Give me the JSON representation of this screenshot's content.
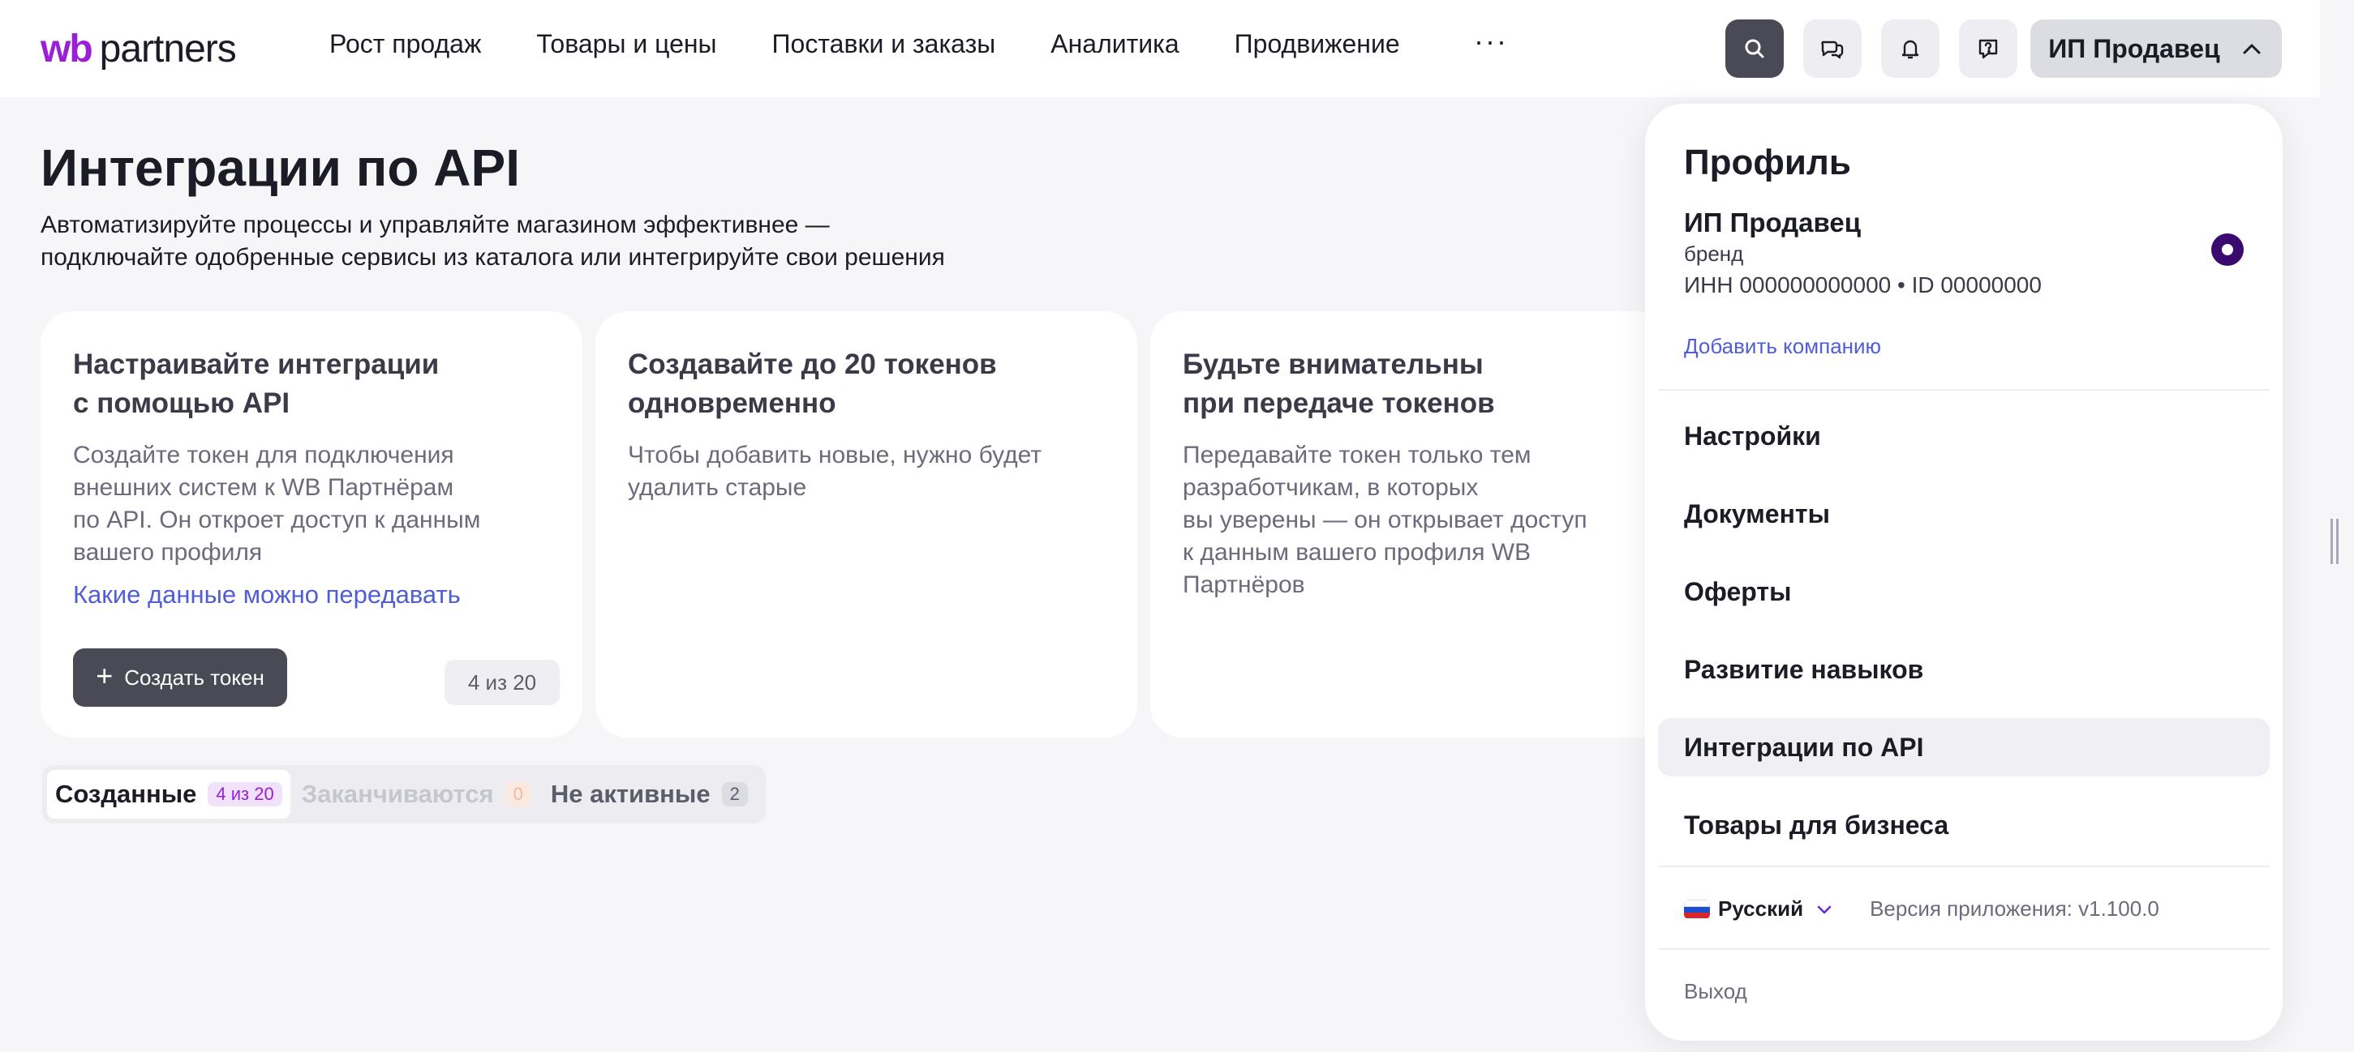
{
  "header": {
    "logo": {
      "wb": "wb",
      "partners": "partners"
    },
    "nav": [
      {
        "label": "Рост продаж"
      },
      {
        "label": "Товары и цены"
      },
      {
        "label": "Поставки и заказы"
      },
      {
        "label": "Аналитика"
      },
      {
        "label": "Продвижение"
      }
    ],
    "more": "···",
    "icons": [
      "search-icon",
      "chat-icon",
      "bell-icon",
      "support-icon"
    ],
    "profile_button": "ИП Продавец"
  },
  "main": {
    "title": "Интеграции по API",
    "subtitle": [
      "Автоматизируйте процессы и управляйте магазином эффективнее —",
      "подключайте одобренные сервисы из каталога или интегрируйте свои решения"
    ],
    "cards": [
      {
        "title": [
          "Настраивайте интеграции",
          "с помощью API"
        ],
        "text": [
          "Создайте токен для подключения",
          "внешних систем к WB Партнёрам",
          "по API. Он откроет доступ к данным",
          "вашего профиля"
        ],
        "link": "Какие данные можно передавать",
        "button": "Создать токен",
        "counter": "4 из 20"
      },
      {
        "title": [
          "Создавайте до 20 токенов",
          "одновременно"
        ],
        "text": [
          "Чтобы добавить новые, нужно будет",
          "удалить старые"
        ]
      },
      {
        "title": [
          "Будьте внимательны",
          "при передаче токенов"
        ],
        "text": [
          "Передавайте токен только тем",
          "разработчикам, в которых",
          "вы уверены — он открывает доступ",
          "к данным вашего профиля WB",
          "Партнёров"
        ]
      }
    ],
    "tabs": [
      {
        "label": "Созданные",
        "badge": "4 из 20",
        "state": "active"
      },
      {
        "label": "Заканчиваются",
        "badge": "0",
        "state": "disabled"
      },
      {
        "label": "Не активные",
        "badge": "2",
        "state": "normal"
      }
    ]
  },
  "dropdown": {
    "title": "Профиль",
    "company": "ИП Продавец",
    "type": "бренд",
    "ids": "ИНН 000000000000 • ID 00000000",
    "add_company": "Добавить компанию",
    "menu": [
      {
        "label": "Настройки"
      },
      {
        "label": "Документы"
      },
      {
        "label": "Оферты"
      },
      {
        "label": "Развитие навыков"
      },
      {
        "label": "Интеграции по API",
        "selected": true
      },
      {
        "label": "Товары для бизнеса"
      }
    ],
    "language": "Русский",
    "version": "Версия приложения: v1.100.0",
    "logout": "Выход"
  },
  "colors": {
    "brand": "#9b1fd6",
    "link": "#4f5ed4",
    "dark_button": "#4a4a57"
  }
}
